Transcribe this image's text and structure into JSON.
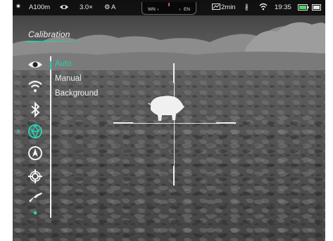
{
  "status_bar": {
    "zoom_range": "A100m",
    "magnification": "3.0×",
    "calibration_mode": "A",
    "compass_left": "WN",
    "compass_right": "EN",
    "recording_time": "2min",
    "time": "19:35"
  },
  "icons": {
    "status": [
      "sun-icon",
      "eye-icon",
      "calibration-mode-icon",
      "video-record-icon",
      "bluetooth-icon",
      "wifi-icon",
      "battery-icon",
      "external-battery-icon"
    ],
    "side_menu": [
      "eye-icon",
      "wifi-icon",
      "bluetooth-icon",
      "calibration-icon",
      "compass-icon",
      "zeroing-icon",
      "rifle-icon"
    ]
  },
  "menu": {
    "title": "Calibration",
    "options": [
      {
        "label": "Auto",
        "active": true
      },
      {
        "label": "Manual",
        "active": false
      },
      {
        "label": "Background",
        "active": false
      }
    ]
  },
  "colors": {
    "accent": "#2ad0b0",
    "compass_marker": "#e04848",
    "battery": "#4cd964"
  }
}
